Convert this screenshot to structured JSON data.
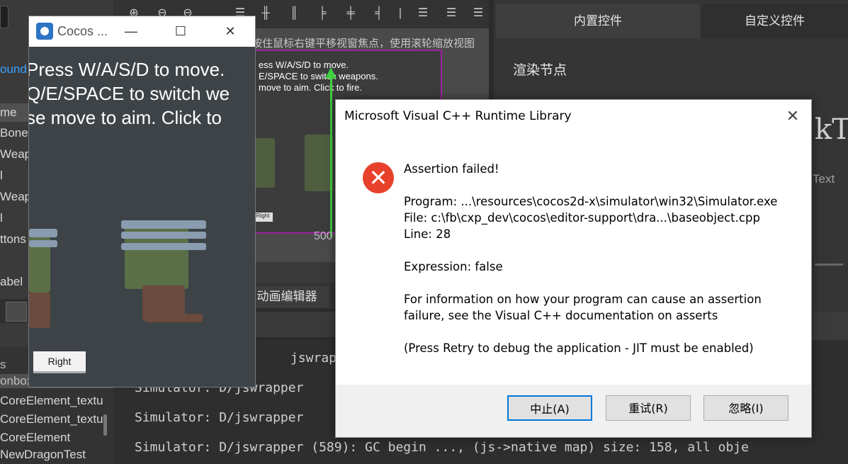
{
  "left_tree": {
    "items": [
      {
        "label": "ound",
        "style": "blue"
      },
      {
        "label": "me",
        "style": "sel"
      },
      {
        "label": "Bone",
        "style": ""
      },
      {
        "label": "Weap",
        "style": ""
      },
      {
        "label": "l",
        "style": ""
      },
      {
        "label": "Weap",
        "style": ""
      },
      {
        "label": "l",
        "style": ""
      },
      {
        "label": "ttons",
        "style": ""
      },
      {
        "label": "abel",
        "style": ""
      }
    ],
    "bottom_items": [
      {
        "label": "s"
      },
      {
        "label": "onbox"
      },
      {
        "label": "CoreElement_textu"
      },
      {
        "label": "CoreElement_textu"
      },
      {
        "label": "CoreElement"
      },
      {
        "label": "NewDragonTest"
      }
    ]
  },
  "scene": {
    "hint": "按住鼠标右键平移视窗焦点，使用滚轮缩放视图",
    "mini_lines": [
      "ess W/A/S/D to move.",
      "E/SPACE to switch weapons.",
      "move to aim. Click to fire."
    ],
    "mini_button": "Right",
    "axis_label": "500"
  },
  "anim_tab": "动画编辑器",
  "console": {
    "lines": [
      "jswrapper",
      "Simulator: D/jswrapper",
      "Simulator: D/jswrapper",
      "Simulator: D/jswrapper (589): GC begin ..., (js->native map) size: 158, all obje"
    ]
  },
  "right_panel": {
    "tabs": [
      "内置控件",
      "自定义控件"
    ],
    "section_title": "渲染节点",
    "big_glyph": "kT",
    "text_label": "Text"
  },
  "simulator": {
    "title": "Cocos ...",
    "hud_lines": [
      "Press W/A/S/D to move.",
      "Q/E/SPACE to switch we",
      "se move to aim. Click to"
    ],
    "right_button": "Right"
  },
  "dialog": {
    "title": "Microsoft Visual C++ Runtime Library",
    "heading": "Assertion failed!",
    "program": "Program: ...\\resources\\cocos2d-x\\simulator\\win32\\Simulator.exe",
    "file": "File: c:\\fb\\cxp_dev\\cocos\\editor-support\\dra...\\baseobject.cpp",
    "line": "Line: 28",
    "expression": "Expression: false",
    "info_line1": "For information on how your program can cause an assertion",
    "info_line2": "failure, see the Visual C++ documentation on asserts",
    "retry_note": "(Press Retry to debug the application - JIT must be enabled)",
    "buttons": {
      "abort": "中止(A)",
      "retry": "重试(R)",
      "ignore": "忽略(I)"
    }
  },
  "colors": {
    "error_icon": "#e8412b",
    "default_button_border": "#0078d7",
    "design_frame": "#a020a0",
    "gizmo_axis": "#3fcf3f"
  }
}
